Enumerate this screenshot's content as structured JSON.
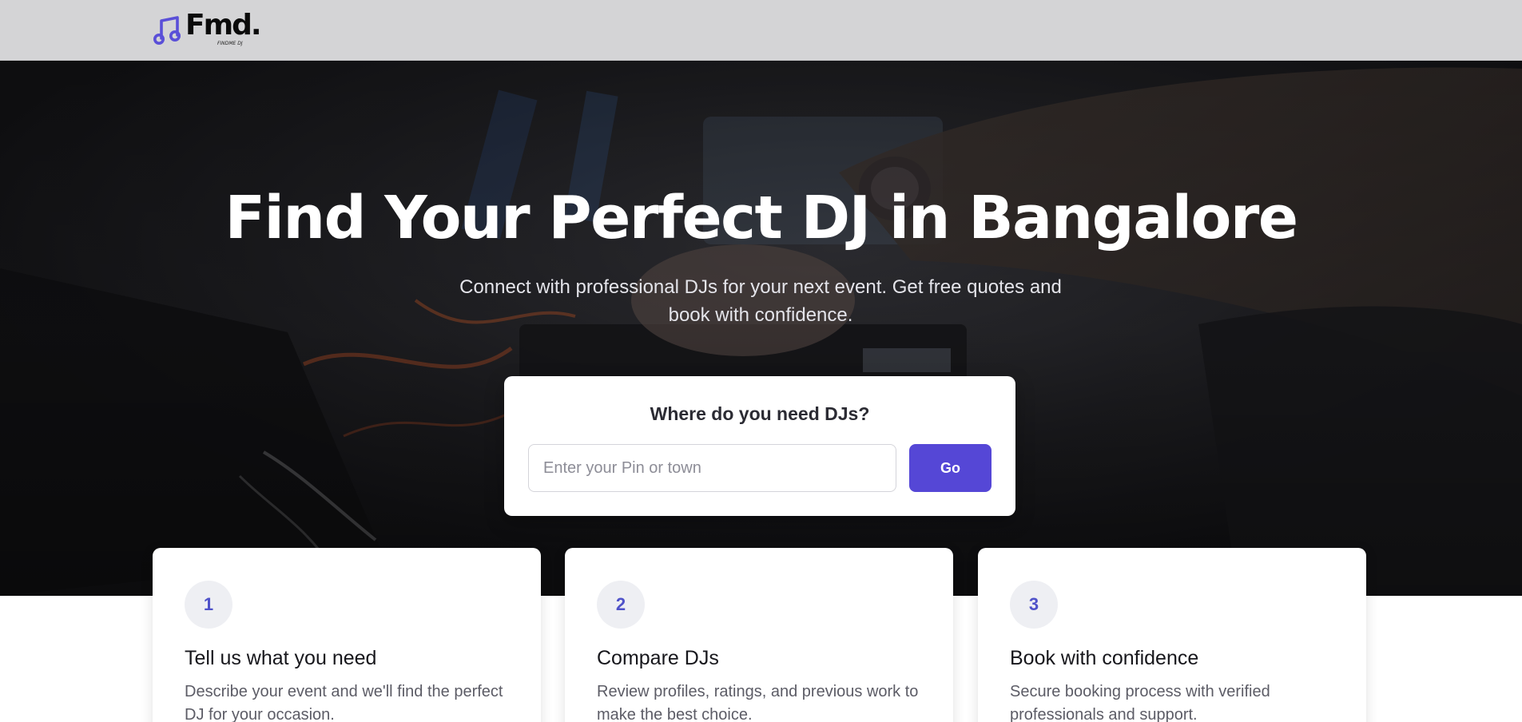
{
  "header": {
    "logo_text": "Fmd.",
    "logo_subtext": "FINDME DJ",
    "logo_icon": "music-note-icon",
    "background": "#d4d4d6"
  },
  "hero": {
    "title": "Find Your Perfect DJ in Bangalore",
    "subtitle": "Connect with professional DJs for your next event. Get free quotes and book with confidence."
  },
  "search": {
    "title": "Where do you need DJs?",
    "placeholder": "Enter your Pin or town",
    "value": "",
    "button_label": "Go"
  },
  "steps": [
    {
      "number": "1",
      "title": "Tell us what you need",
      "description": "Describe your event and we'll find the perfect DJ for your occasion."
    },
    {
      "number": "2",
      "title": "Compare DJs",
      "description": "Review profiles, ratings, and previous work to make the best choice."
    },
    {
      "number": "3",
      "title": "Book with confidence",
      "description": "Secure booking process with verified professionals and support."
    }
  ],
  "colors": {
    "accent": "#5547d6",
    "step_number": "#4f52c9",
    "logo_icon": "#5a4fd8"
  }
}
